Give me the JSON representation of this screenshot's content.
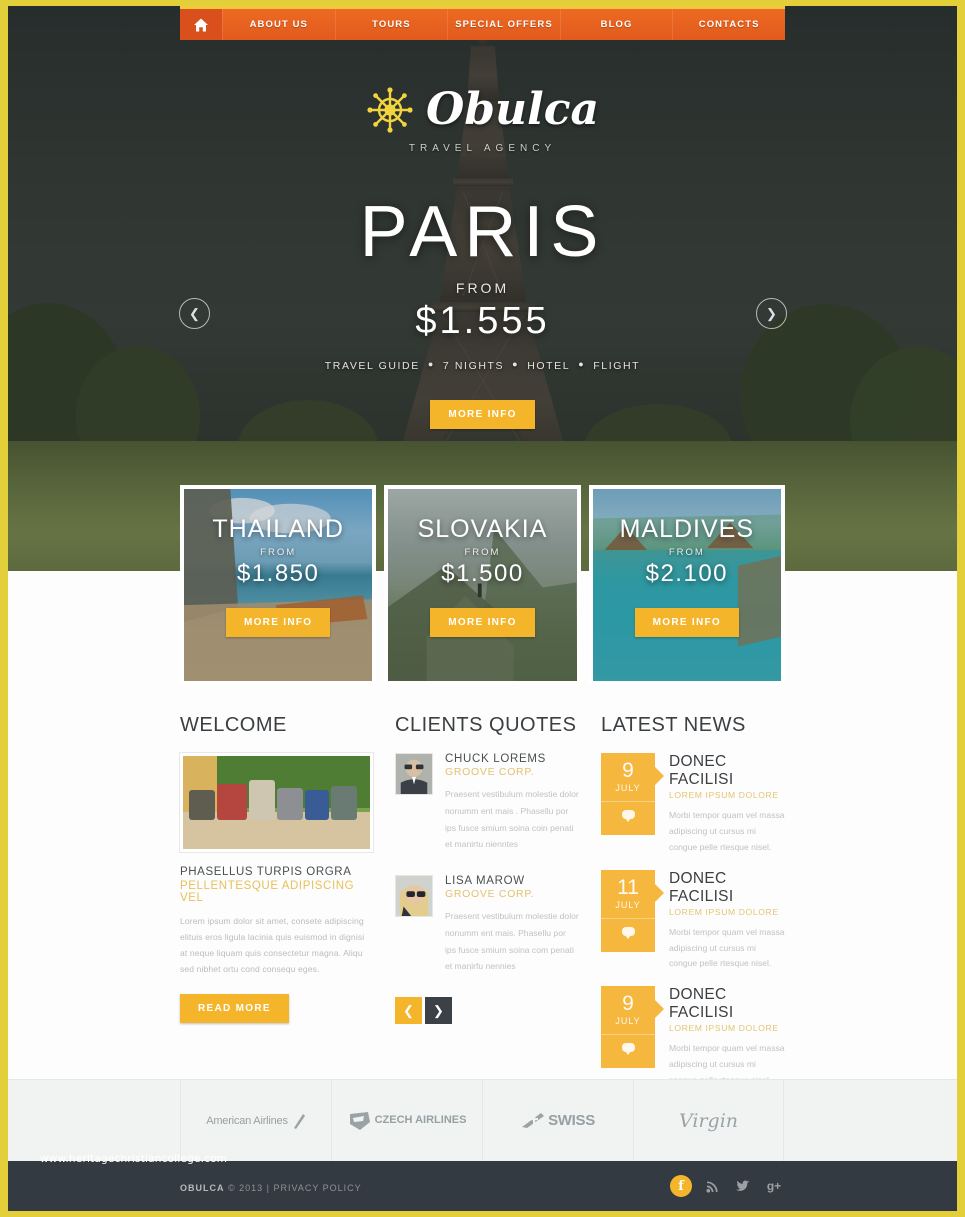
{
  "nav": {
    "home_icon": "home-icon",
    "items": [
      {
        "label": "ABOUT US"
      },
      {
        "label": "TOURS"
      },
      {
        "label": "SPECIAL OFFERS"
      },
      {
        "label": "BLOG"
      },
      {
        "label": "CONTACTS"
      }
    ]
  },
  "logo": {
    "icon": "ship-wheel-icon",
    "name": "Obulca",
    "tagline": "TRAVEL AGENCY"
  },
  "hero": {
    "title": "PARIS",
    "from_label": "FROM",
    "price": "$1.555",
    "features": [
      "TRAVEL GUIDE",
      "7 NIGHTS",
      "HOTEL",
      "FLIGHT"
    ],
    "cta": "MORE INFO",
    "prev_icon": "chevron-left-icon",
    "next_icon": "chevron-right-icon"
  },
  "cards": [
    {
      "title": "THAILAND",
      "from_label": "FROM",
      "price": "$1.850",
      "cta": "MORE INFO"
    },
    {
      "title": "SLOVAKIA",
      "from_label": "FROM",
      "price": "$1.500",
      "cta": "MORE INFO"
    },
    {
      "title": "MALDIVES",
      "from_label": "FROM",
      "price": "$2.100",
      "cta": "MORE INFO"
    }
  ],
  "welcome": {
    "heading": "WELCOME",
    "image_alt": "suitcases-photo",
    "subtitle_1": "PHASELLUS TURPIS ORGRA",
    "subtitle_2": "PELLENTESQUE ADIPISCING VEL",
    "body": "Lorem ipsum dolor sit amet, consete adipiscing elituis eros ligula lacinia quis euismod in dignisi at neque liquam quis consectetur magna. Aliqu sed nibhet ortu cond consequ eges.",
    "cta": "READ MORE"
  },
  "quotes": {
    "heading": "CLIENTS QUOTES",
    "items": [
      {
        "name": "CHUCK LOREMS",
        "company": "GROOVE CORP.",
        "text": "Praesent vestibulum molestie dolor nonumm ent mais . Phasellu por ips fusce smium soina coin penati et manirtu nienntes"
      },
      {
        "name": "LISA MAROW",
        "company": "GROOVE CORP.",
        "text": "Praesent vestibulum molestie dolor nonumm ent mais. Phasellu por ips fusce smium soina com penati et manirfu nennies"
      }
    ],
    "prev_icon": "chevron-left-icon",
    "next_icon": "chevron-right-icon"
  },
  "news": {
    "heading": "LATEST NEWS",
    "items": [
      {
        "day": "9",
        "month": "JULY",
        "title": "DONEC FACILISI",
        "subtitle": "LOREM IPSUM DOLORE",
        "text": "Morbi tempor quam vel massa adipiscing ut cursus mi congue pelle rtesque nisel."
      },
      {
        "day": "11",
        "month": "JULY",
        "title": "DONEC FACILISI",
        "subtitle": "LOREM IPSUM DOLORE",
        "text": "Morbi tempor quam vel massa adipiscing ut cursus mi congue pelle rtesque nisel."
      },
      {
        "day": "9",
        "month": "JULY",
        "title": "DONEC FACILISI",
        "subtitle": "LOREM IPSUM DOLORE",
        "text": "Morbi tempor quam vel massa adipiscing ut cursus mi congue pelle rtesque nisel."
      }
    ],
    "comment_icon": "comment-bubble-icon"
  },
  "partners": [
    {
      "name": "American Airlines",
      "icon": "american-airlines-logo"
    },
    {
      "name": "CZECH AIRLINES",
      "icon": "czech-airlines-logo"
    },
    {
      "name": "SWISS",
      "icon": "swiss-logo"
    },
    {
      "name": "Virgin",
      "icon": "virgin-logo"
    }
  ],
  "footer": {
    "watermark": "www.heritagechristiancollege.com",
    "brand": "OBULCA",
    "copyright": " © 2013 | PRIVACY POLICY",
    "socials": [
      {
        "name": "facebook-icon",
        "glyph": "f",
        "active": true
      },
      {
        "name": "rss-icon",
        "glyph": "◔",
        "active": false
      },
      {
        "name": "twitter-icon",
        "glyph": "ᵗ",
        "active": false
      },
      {
        "name": "google-plus-icon",
        "glyph": "g+",
        "active": false
      }
    ]
  },
  "colors": {
    "accent_amber": "#f4b52a",
    "nav_orange": "#e25a1d",
    "frame_yellow": "#e2cf3a",
    "footer_dark": "#343a41"
  }
}
